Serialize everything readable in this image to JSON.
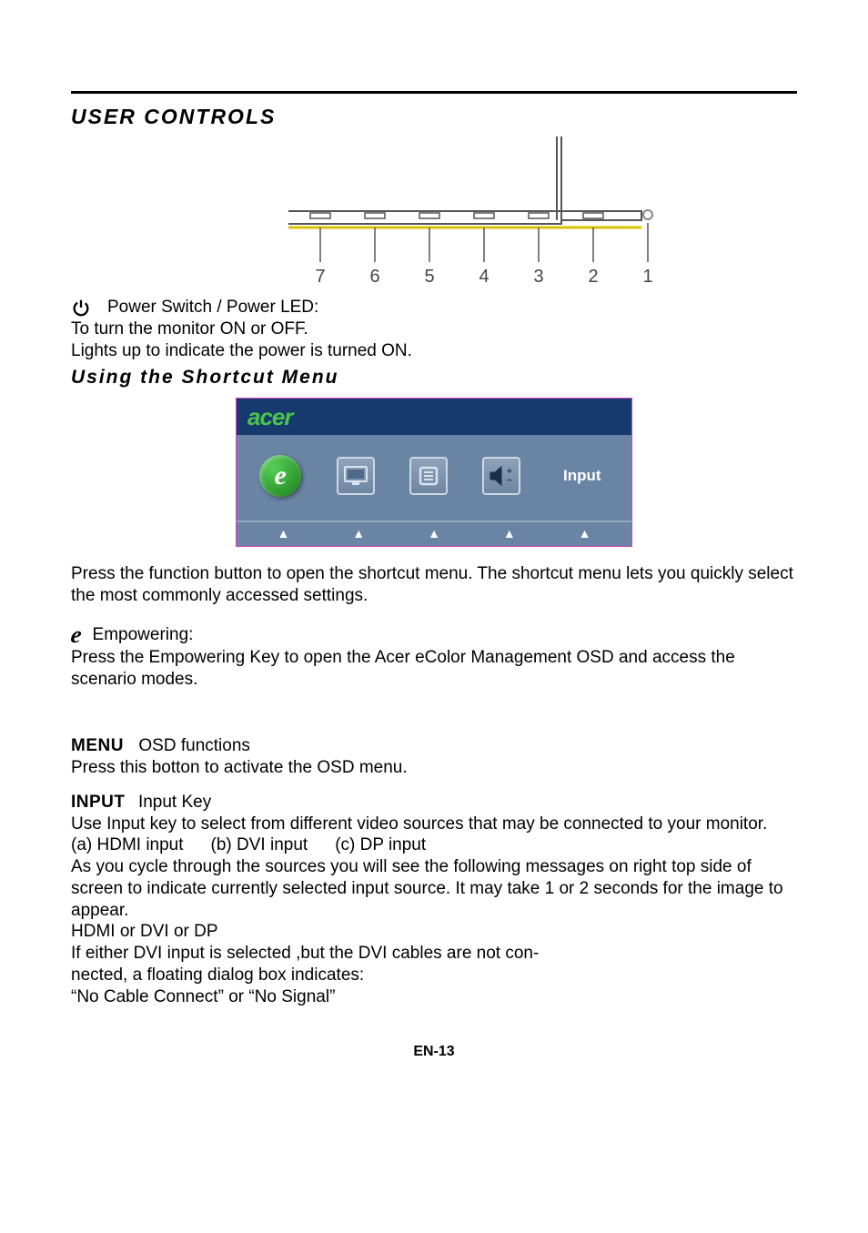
{
  "section_title": "USER CONTROLS",
  "diagram": {
    "labels": [
      "7",
      "6",
      "5",
      "4",
      "3",
      "2",
      "1"
    ]
  },
  "power": {
    "title": "Power Switch / Power LED:",
    "line1": "To turn the monitor ON or OFF.",
    "line2": "Lights up to indicate the power is turned ON."
  },
  "shortcut_heading": "Using  the Shortcut Menu",
  "osd": {
    "brand": "acer",
    "input_label": "Input",
    "tiles": [
      "empowering",
      "screen",
      "menu",
      "volume",
      "input"
    ]
  },
  "shortcut_intro": "Press the function button to open the shortcut menu. The shortcut menu lets you quickly select the most commonly accessed settings.",
  "empowering": {
    "title": "Empowering:",
    "body": "Press the Empowering Key to open the Acer eColor Management OSD and access the scenario modes."
  },
  "osdfunc": {
    "tag": "MENU",
    "title": "OSD functions",
    "body": "Press this botton to activate the OSD menu."
  },
  "input": {
    "tag": "INPUT",
    "title": "Input Key",
    "line1": "Use Input key to select from different video sources that may be connected to your monitor.",
    "opts": {
      "a": "(a) HDMI input",
      "b": "(b) DVI input",
      "c": "(c) DP input"
    },
    "line2": "As you cycle through the sources you will see the following messages on right top side of screen to indicate currently selected input source. It may take 1 or 2 seconds for the image to appear.",
    "line3": "HDMI  or  DVI  or  DP",
    "line4": "If either DVI input is selected ,but the DVI cables are not con-",
    "line5": "nected, a floating dialog box indicates:",
    "line6": "“No Cable Connect” or “No Signal”"
  },
  "footer": "EN-13"
}
